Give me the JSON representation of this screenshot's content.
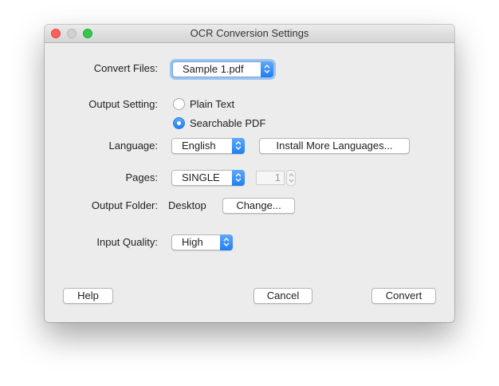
{
  "window": {
    "title": "OCR Conversion Settings"
  },
  "convert_files": {
    "label": "Convert Files:",
    "value": "Sample 1.pdf"
  },
  "output_setting": {
    "label": "Output Setting:",
    "options": [
      {
        "label": "Plain Text",
        "selected": false
      },
      {
        "label": "Searchable PDF",
        "selected": true
      }
    ]
  },
  "language": {
    "label": "Language:",
    "value": "English",
    "install_button": "Install More Languages..."
  },
  "pages": {
    "label": "Pages:",
    "value": "SINGLE",
    "page_number": "1"
  },
  "output_folder": {
    "label": "Output Folder:",
    "value": "Desktop",
    "change_button": "Change..."
  },
  "input_quality": {
    "label": "Input Quality:",
    "value": "High"
  },
  "footer": {
    "help": "Help",
    "cancel": "Cancel",
    "convert": "Convert"
  },
  "colors": {
    "accent": "#1f7ef2",
    "window_bg": "#ececec",
    "close": "#fc605c",
    "maximize": "#34c84a"
  },
  "icons": {
    "popup_arrows": "up-down-chevron-icon",
    "radio_selected": "radio-selected-icon"
  }
}
